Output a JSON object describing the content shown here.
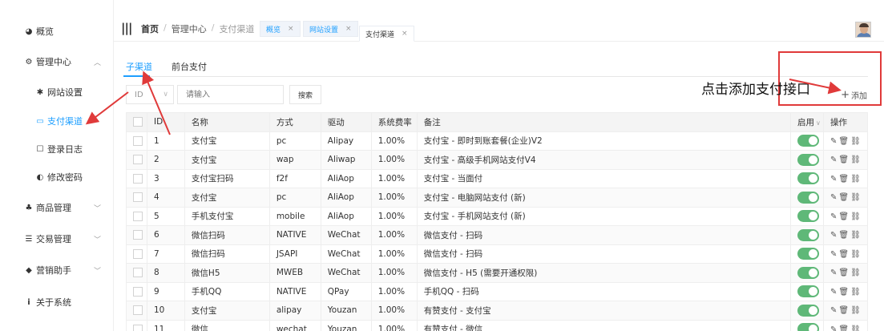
{
  "sidebar": {
    "items": [
      {
        "label": "概览",
        "icon": "dashboard-icon"
      },
      {
        "label": "管理中心",
        "icon": "gears-icon"
      },
      {
        "label": "网站设置",
        "icon": "gear-icon"
      },
      {
        "label": "支付渠道",
        "icon": "card-icon"
      },
      {
        "label": "登录日志",
        "icon": "log-icon"
      },
      {
        "label": "修改密码",
        "icon": "shield-icon"
      },
      {
        "label": "商品管理",
        "icon": "goods-icon"
      },
      {
        "label": "交易管理",
        "icon": "list-icon"
      },
      {
        "label": "营销助手",
        "icon": "tag-icon"
      },
      {
        "label": "关于系统",
        "icon": "info-icon"
      }
    ]
  },
  "header": {
    "breadcrumb": {
      "home": "首页",
      "level2": "管理中心",
      "level3": "支付渠道"
    },
    "tabs": [
      {
        "label": "概览",
        "close": "×"
      },
      {
        "label": "网站设置",
        "close": "×"
      },
      {
        "label": "支付渠道",
        "close": "×"
      }
    ]
  },
  "content": {
    "tabs": [
      {
        "label": "子渠道"
      },
      {
        "label": "前台支付"
      }
    ],
    "filter": {
      "select_value": "ID",
      "input_placeholder": "请输入",
      "search_label": "搜索"
    },
    "add_label": "添加"
  },
  "table": {
    "headers": [
      "ID",
      "名称",
      "方式",
      "驱动",
      "系统费率",
      "备注",
      "启用",
      "操作"
    ],
    "rows": [
      {
        "id": "1",
        "name": "支付宝",
        "method": "pc",
        "driver": "Alipay",
        "rate": "1.00%",
        "note": "支付宝 - 即时到账套餐(企业)V2"
      },
      {
        "id": "2",
        "name": "支付宝",
        "method": "wap",
        "driver": "Aliwap",
        "rate": "1.00%",
        "note": "支付宝 - 高级手机网站支付V4"
      },
      {
        "id": "3",
        "name": "支付宝扫码",
        "method": "f2f",
        "driver": "AliAop",
        "rate": "1.00%",
        "note": "支付宝 - 当面付"
      },
      {
        "id": "4",
        "name": "支付宝",
        "method": "pc",
        "driver": "AliAop",
        "rate": "1.00%",
        "note": "支付宝 - 电脑网站支付 (新)"
      },
      {
        "id": "5",
        "name": "手机支付宝",
        "method": "mobile",
        "driver": "AliAop",
        "rate": "1.00%",
        "note": "支付宝 - 手机网站支付 (新)"
      },
      {
        "id": "6",
        "name": "微信扫码",
        "method": "NATIVE",
        "driver": "WeChat",
        "rate": "1.00%",
        "note": "微信支付 - 扫码"
      },
      {
        "id": "7",
        "name": "微信扫码",
        "method": "JSAPI",
        "driver": "WeChat",
        "rate": "1.00%",
        "note": "微信支付 - 扫码"
      },
      {
        "id": "8",
        "name": "微信H5",
        "method": "MWEB",
        "driver": "WeChat",
        "rate": "1.00%",
        "note": "微信支付 - H5 (需要开通权限)"
      },
      {
        "id": "9",
        "name": "手机QQ",
        "method": "NATIVE",
        "driver": "QPay",
        "rate": "1.00%",
        "note": "手机QQ - 扫码"
      },
      {
        "id": "10",
        "name": "支付宝",
        "method": "alipay",
        "driver": "Youzan",
        "rate": "1.00%",
        "note": "有赞支付 - 支付宝"
      },
      {
        "id": "11",
        "name": "微信",
        "method": "wechat",
        "driver": "Youzan",
        "rate": "1.00%",
        "note": "有赞支付 - 微信"
      }
    ]
  },
  "annotation": {
    "text": "点击添加支付接口",
    "color": "#e03a3a"
  },
  "colors": {
    "accent": "#1e9fff",
    "toggle_on": "#5fb878"
  }
}
